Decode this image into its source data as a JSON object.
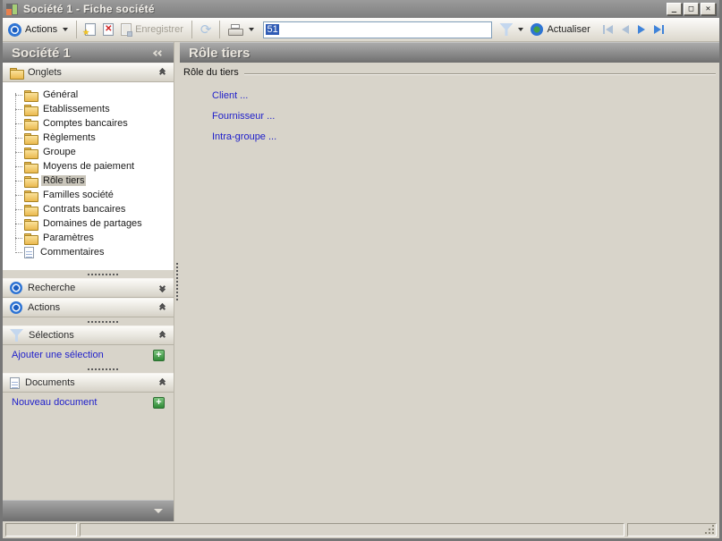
{
  "window": {
    "title": "Société 1 -  Fiche société"
  },
  "toolbar": {
    "actions_label": "Actions",
    "save_label": "Enregistrer",
    "filter_value": "51",
    "refresh_label": "Actualiser"
  },
  "sidebar": {
    "title": "Société 1",
    "groups": {
      "onglets": "Onglets",
      "recherche": "Recherche",
      "actions": "Actions",
      "selections": "Sélections",
      "documents": "Documents"
    },
    "tree": [
      {
        "label": "Général",
        "icon": "folder"
      },
      {
        "label": "Etablissements",
        "icon": "folder"
      },
      {
        "label": "Comptes bancaires",
        "icon": "folder"
      },
      {
        "label": "Règlements",
        "icon": "folder"
      },
      {
        "label": "Groupe",
        "icon": "folder"
      },
      {
        "label": "Moyens de paiement",
        "icon": "folder"
      },
      {
        "label": "Rôle tiers",
        "icon": "folder-open",
        "selected": true
      },
      {
        "label": "Familles société",
        "icon": "folder"
      },
      {
        "label": "Contrats bancaires",
        "icon": "folder"
      },
      {
        "label": "Domaines de partages",
        "icon": "folder"
      },
      {
        "label": "Paramètres",
        "icon": "folder"
      },
      {
        "label": "Commentaires",
        "icon": "note"
      }
    ],
    "links": {
      "add_selection": "Ajouter une sélection",
      "new_document": "Nouveau document"
    }
  },
  "main": {
    "header": "Rôle tiers",
    "group_label": "Rôle du tiers",
    "links": [
      "Client ...",
      "Fournisseur ...",
      "Intra-groupe ..."
    ]
  },
  "colors": {
    "accent_blue": "#2e74d4",
    "link_blue": "#2121cb",
    "selection_blue": "#2f5bb5",
    "green_plus": "#3f9d46",
    "titlebar_gray": "#8a8a8a"
  }
}
